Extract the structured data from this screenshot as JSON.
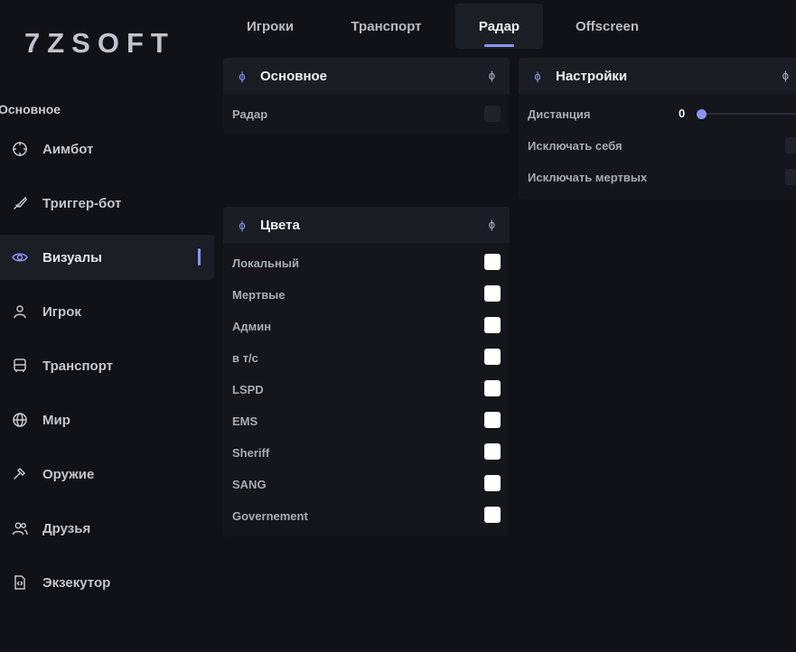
{
  "logo": "7ZSOFT",
  "sidebar": {
    "section_label": "Основное",
    "items": [
      {
        "label": "Аимбот",
        "icon": "crosshair-icon"
      },
      {
        "label": "Триггер-бот",
        "icon": "knife-icon"
      },
      {
        "label": "Визуалы",
        "icon": "eye-icon",
        "active": true
      },
      {
        "label": "Игрок",
        "icon": "user-icon"
      },
      {
        "label": "Транспорт",
        "icon": "bus-icon"
      },
      {
        "label": "Мир",
        "icon": "globe-icon"
      },
      {
        "label": "Оружие",
        "icon": "hammer-icon"
      },
      {
        "label": "Друзья",
        "icon": "users-icon"
      },
      {
        "label": "Экзекутор",
        "icon": "code-file-icon"
      }
    ]
  },
  "tabs": [
    {
      "label": "Игроки"
    },
    {
      "label": "Транспорт"
    },
    {
      "label": "Радар",
      "active": true
    },
    {
      "label": "Offscreen"
    }
  ],
  "panels": {
    "main": {
      "title": "Основное",
      "rows": [
        {
          "label": "Радар",
          "checked": false
        }
      ]
    },
    "colors": {
      "title": "Цвета",
      "rows": [
        {
          "label": "Локальный",
          "color": "#ffffff"
        },
        {
          "label": "Мертвые",
          "color": "#ffffff"
        },
        {
          "label": "Админ",
          "color": "#ffffff"
        },
        {
          "label": "в т/с",
          "color": "#ffffff"
        },
        {
          "label": "LSPD",
          "color": "#ffffff"
        },
        {
          "label": "EMS",
          "color": "#ffffff"
        },
        {
          "label": "Sheriff",
          "color": "#ffffff"
        },
        {
          "label": "SANG",
          "color": "#ffffff"
        },
        {
          "label": "Governement",
          "color": "#ffffff"
        }
      ]
    },
    "settings": {
      "title": "Настройки",
      "distance_label": "Дистанция",
      "distance_value": "0",
      "exclude_self_label": "Исключать себя",
      "exclude_dead_label": "Исключать мертвых"
    }
  },
  "panel_header_glyph": "ϕ",
  "accent_color": "#8b93f0"
}
